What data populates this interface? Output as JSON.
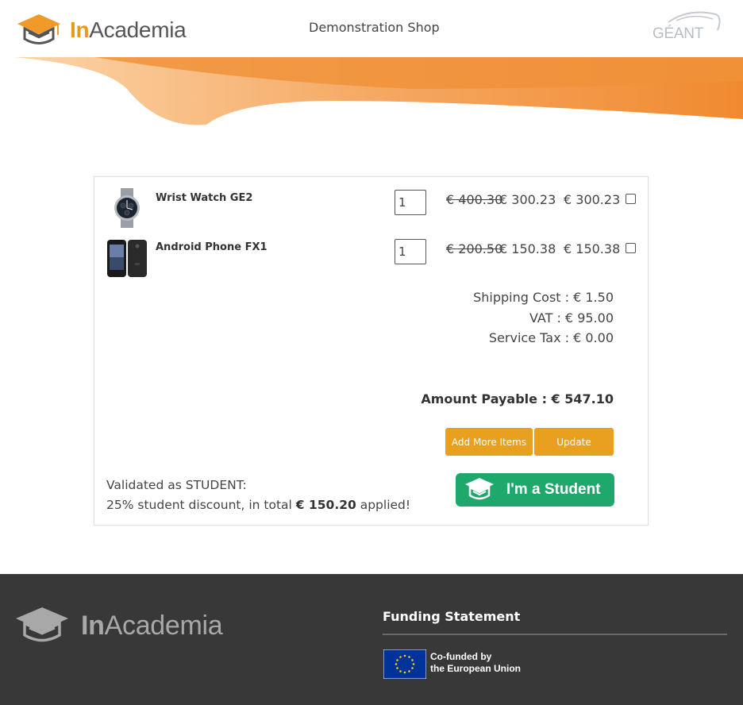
{
  "header": {
    "logo_prefix": "In",
    "logo_suffix": "Academia",
    "shop_title": "Demonstration Shop",
    "partner_logo": "GÉANT"
  },
  "cart": {
    "items": [
      {
        "name": "Wrist Watch GE2",
        "image": "watch-image",
        "quantity": "1",
        "old_price": "€ 400.30",
        "new_price": "€ 300.23",
        "total": "€ 300.23"
      },
      {
        "name": "Android Phone FX1",
        "image": "phone-image",
        "quantity": "1",
        "old_price": "€ 200.50",
        "new_price": "€ 150.38",
        "total": "€ 150.38"
      }
    ],
    "shipping": "Shipping Cost : € 1.50",
    "vat": "VAT : € 95.00",
    "service_tax": "Service Tax : € 0.00",
    "amount_payable": "Amount Payable : € 547.10",
    "add_more_label": "Add More Items",
    "update_label": "Update",
    "validated_line1": "Validated as STUDENT:",
    "validated_line2_prefix": "25% student discount, in total ",
    "validated_amount": "€ 150.20",
    "validated_line2_suffix": " applied!",
    "student_button_label": "I'm a Student"
  },
  "footer": {
    "logo_prefix": "In",
    "logo_suffix": "Academia",
    "funding_title": "Funding Statement",
    "eu_line1": "Co-funded by",
    "eu_line2": "the European Union"
  },
  "colors": {
    "accent": "#e8a01e",
    "student_green": "#1ea86b",
    "footer_bg": "#383838",
    "wave_orange": "#f0923a"
  }
}
